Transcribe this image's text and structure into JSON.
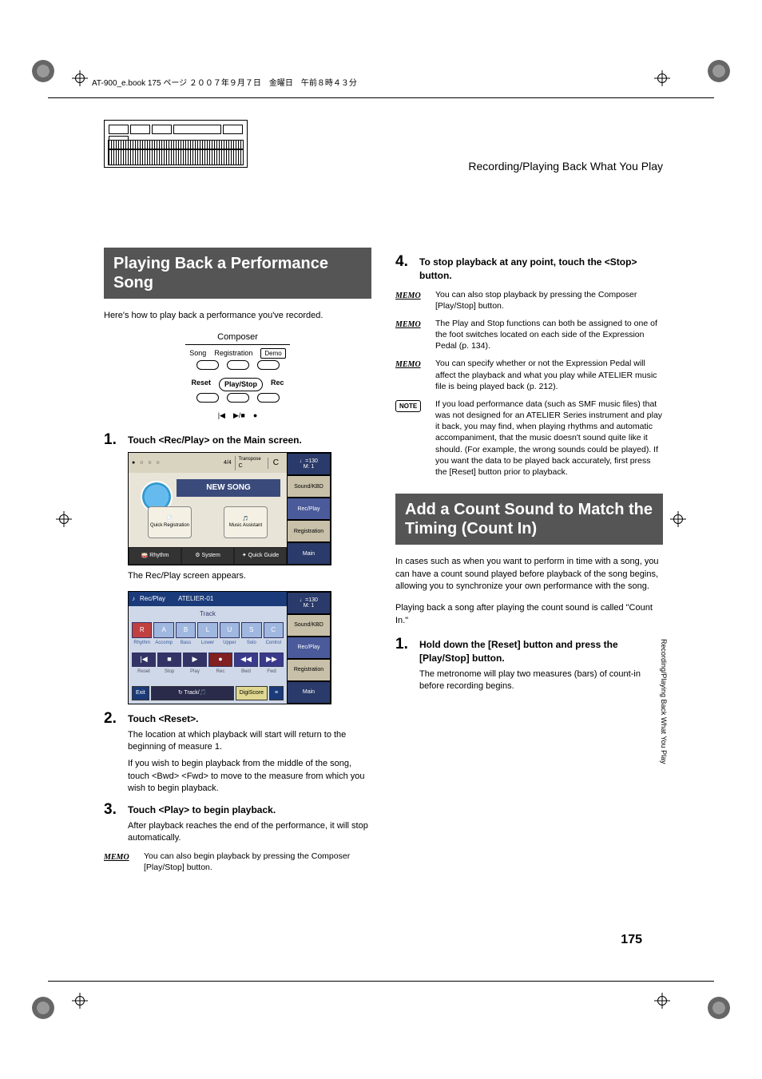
{
  "header_line": "AT-900_e.book  175 ページ  ２００７年９月７日　金曜日　午前８時４３分",
  "section_banner": "Recording/Playing Back What You Play",
  "side_label": "Recording/Playing Back What You Play",
  "page_number": "175",
  "left": {
    "title": "Playing Back a Performance Song",
    "intro": "Here's how to play back a performance you've recorded.",
    "panel": {
      "top_title": "Composer",
      "labels_row1": [
        "Song",
        "Registration"
      ],
      "demo": "Demo",
      "labels_row2": [
        "Reset",
        "Play/Stop",
        "Rec"
      ],
      "icons": [
        "|◀",
        "▶/■",
        "●"
      ]
    },
    "step1": {
      "title": "Touch <Rec/Play> on the Main screen.",
      "caption": "The Rec/Play screen appears."
    },
    "main_screen": {
      "time_sig": "4/4",
      "transpose_label": "Transpose",
      "transpose_val": "C",
      "key": "C",
      "tempo": "♩=130",
      "measure": "M:      1",
      "song_title": "NEW SONG",
      "quick_reg": "Quick Registration",
      "music_asst": "Music Assistant",
      "tabs": [
        "Sound/KBD",
        "Rec/Play",
        "Registration",
        "Main"
      ],
      "bottom_tabs": [
        "🥁 Rhythm",
        "⚙ System",
        "✦ Quick Guide"
      ]
    },
    "rec_screen": {
      "header_left": "Rec/Play",
      "header_right": "ATELIER-01",
      "tempo": "♩=130",
      "measure": "M:      1",
      "track_label": "Track",
      "track_boxes": [
        "R",
        "A",
        "B",
        "L",
        "U",
        "S",
        "C"
      ],
      "track_names": [
        "Rhythm",
        "Accomp",
        "Bass",
        "Lower",
        "Upper",
        "Solo",
        "Control"
      ],
      "transport_labels": [
        "Reset",
        "Stop",
        "Play",
        "Rec",
        "Bwd",
        "Fwd"
      ],
      "exit": "Exit",
      "track_btn": "↻ Track/",
      "digiscore": "DigiScore",
      "tabs": [
        "Sound/KBD",
        "Rec/Play",
        "Registration",
        "Main"
      ]
    },
    "step2": {
      "title": "Touch <Reset>.",
      "body1": "The location at which playback will start will return to the beginning of measure 1.",
      "body2": "If you wish to begin playback from the middle of the song, touch <Bwd> <Fwd> to move to the measure from which you wish to begin playback."
    },
    "step3": {
      "title": "Touch <Play> to begin playback.",
      "body": "After playback reaches the end of the performance, it will stop automatically."
    },
    "memo3": "You can also begin playback by pressing the Composer [Play/Stop] button."
  },
  "right": {
    "step4": {
      "title": "To stop playback at any point, touch the <Stop> button."
    },
    "memo_a": "You can also stop playback by pressing the Composer [Play/Stop] button.",
    "memo_b": "The Play and Stop functions can both be assigned to one of the foot switches located on each side of the Expression Pedal (p. 134).",
    "memo_c": "You can specify whether or not the Expression Pedal will affect the playback and what you play while ATELIER music file is being played back (p. 212).",
    "note": "If you load performance data (such as SMF music files) that was not designed for an ATELIER Series instrument and play it back, you may find, when playing rhythms and automatic accompaniment, that the music doesn't sound quite like it should. (For example, the wrong sounds could be played). If you want the data to be played back accurately, first press the [Reset] button prior to playback.",
    "title2": "Add a Count Sound to Match the Timing (Count In)",
    "intro2a": "In cases such as when you want to perform in time with a song, you can have a count sound played before playback of the song begins, allowing you to synchronize your own performance with the song.",
    "intro2b": "Playing back a song after playing the count sound is called \"Count In.\"",
    "step1b": {
      "title": "Hold down the [Reset] button and press the [Play/Stop] button.",
      "body": "The metronome will play two measures (bars) of count-in before recording begins."
    }
  },
  "labels": {
    "memo": "MEMO",
    "note": "NOTE"
  }
}
